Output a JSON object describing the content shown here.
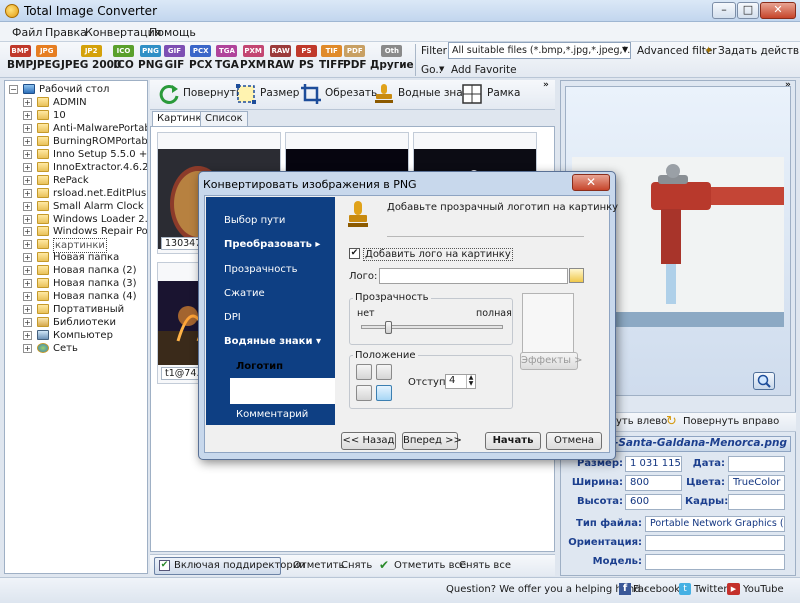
{
  "window": {
    "title": "Total Image Converter",
    "btn_min": "–",
    "btn_max": "□",
    "btn_close": "✕"
  },
  "menu": [
    "Файл",
    "Правка",
    "Конвертация",
    "Помощь"
  ],
  "formats": [
    {
      "badge": "BMP",
      "label": "BMP",
      "color": "#c0392b"
    },
    {
      "badge": "JPG",
      "label": "JPEG",
      "color": "#e67e22"
    },
    {
      "badge": "JP2",
      "label": "JPEG 2000",
      "color": "#d4a10a"
    },
    {
      "badge": "ICO",
      "label": "ICO",
      "color": "#5aa02c"
    },
    {
      "badge": "PNG",
      "label": "PNG",
      "color": "#2f8fc6"
    },
    {
      "badge": "GIF",
      "label": "GIF",
      "color": "#7d4fb3"
    },
    {
      "badge": "PCX",
      "label": "PCX",
      "color": "#3a66c9"
    },
    {
      "badge": "TGA",
      "label": "TGA",
      "color": "#b0449b"
    },
    {
      "badge": "PXM",
      "label": "PXM",
      "color": "#c34672"
    },
    {
      "badge": "RAW",
      "label": "RAW",
      "color": "#9c3b3b"
    },
    {
      "badge": "PS",
      "label": "PS",
      "color": "#c0392b"
    },
    {
      "badge": "TIF",
      "label": "TIFF",
      "color": "#e08a2a"
    },
    {
      "badge": "PDF",
      "label": "PDF",
      "color": "#c8a064"
    },
    {
      "badge": "Oth",
      "label": "Другие",
      "color": "#8a8a8a"
    }
  ],
  "filter": {
    "label": "Filter:",
    "value": "All suitable files (*.bmp,*.jpg,*.jpeg,*.ico,*.",
    "advanced": "Advanced filter",
    "set_actions": "Задать действия",
    "go": "Go..",
    "add_favorite": "Add Favorite"
  },
  "tree": [
    {
      "label": "Рабочий стол",
      "level": 0,
      "exp": "−",
      "kind": "desktop"
    },
    {
      "label": "ADMIN",
      "level": 1,
      "exp": "+",
      "kind": "folder"
    },
    {
      "label": "10",
      "level": 1,
      "exp": "+",
      "kind": "folder"
    },
    {
      "label": "Anti-MalwarePortable",
      "level": 1,
      "exp": "+",
      "kind": "folder"
    },
    {
      "label": "BurningROMPortable",
      "level": 1,
      "exp": "+",
      "kind": "folder"
    },
    {
      "label": "Inno Setup 5.5.0 + Rus",
      "level": 1,
      "exp": "+",
      "kind": "folder"
    },
    {
      "label": "InnoExtractor.4.6.2.151",
      "level": 1,
      "exp": "+",
      "kind": "folder"
    },
    {
      "label": "RePack",
      "level": 1,
      "exp": "+",
      "kind": "folder"
    },
    {
      "label": "rsload.net.EditPlus.3.70.1",
      "level": 1,
      "exp": "+",
      "kind": "folder"
    },
    {
      "label": "Small Alarm Clock",
      "level": 1,
      "exp": "+",
      "kind": "folder"
    },
    {
      "label": "Windows Loader 2.2.2 by D",
      "level": 1,
      "exp": "+",
      "kind": "folder"
    },
    {
      "label": "Windows Repair Portable",
      "level": 1,
      "exp": "+",
      "kind": "folder"
    },
    {
      "label": "картинки",
      "level": 1,
      "exp": "+",
      "kind": "folder"
    },
    {
      "label": "Новая папка",
      "level": 1,
      "exp": "+",
      "kind": "folder"
    },
    {
      "label": "Новая папка (2)",
      "level": 1,
      "exp": "+",
      "kind": "folder"
    },
    {
      "label": "Новая папка (3)",
      "level": 1,
      "exp": "+",
      "kind": "folder"
    },
    {
      "label": "Новая папка (4)",
      "level": 1,
      "exp": "+",
      "kind": "folder"
    },
    {
      "label": "Портативный",
      "level": 1,
      "exp": "+",
      "kind": "folder"
    },
    {
      "label": "Библиотеки",
      "level": 1,
      "exp": "+",
      "kind": "library"
    },
    {
      "label": "Компьютер",
      "level": 1,
      "exp": "+",
      "kind": "computer"
    },
    {
      "label": "Сеть",
      "level": 1,
      "exp": "+",
      "kind": "network"
    }
  ],
  "center_toolbar": {
    "rotate": "Повернуть",
    "size": "Размер",
    "crop": "Обрезать",
    "watermarks": "Водные знаки",
    "frame": "Рамка"
  },
  "tabs": {
    "thumbnails": "Картинки",
    "list": "Список"
  },
  "thumbs": [
    {
      "caption": "1303477…"
    },
    {
      "caption": ""
    },
    {
      "caption": ""
    },
    {
      "caption": "t1@74…"
    }
  ],
  "bottom_bar": {
    "include_subdirs": "Включая поддиректории",
    "mark": "Отметить",
    "unmark": "Снять",
    "mark_all": "Отметить все",
    "unmark_all": "Снять все"
  },
  "right_panel": {
    "rotate_left": "уть влево",
    "rotate_right": "Повернуть вправо",
    "filename": "ntain-Santa-Galdana-Menorca.png",
    "size_label": "Размер:",
    "size_value": "1 031 115",
    "date_label": "Дата:",
    "date_value": "",
    "width_label": "Ширина:",
    "width_value": "800",
    "colors_label": "Цвета:",
    "colors_value": "TrueColor",
    "height_label": "Высота:",
    "height_value": "600",
    "frames_label": "Кадры:",
    "frames_value": "",
    "filetype_label": "Тип файла:",
    "filetype_value": "Portable Network Graphics (PNG)",
    "orientation_label": "Ориентация:",
    "orientation_value": "",
    "model_label": "Модель:",
    "model_value": ""
  },
  "status": {
    "question": "Question? We offer you a helping hand -",
    "facebook": "Facebook",
    "twitter": "Twitter",
    "youtube": "YouTube"
  },
  "dialog": {
    "title": "Конвертировать изображения в PNG",
    "close": "✕",
    "nav": [
      {
        "label": "Выбор пути",
        "bold": false,
        "indent": 0
      },
      {
        "label": "Преобразовать ▸",
        "bold": true,
        "indent": 0
      },
      {
        "label": "Прозрачность",
        "bold": false,
        "indent": 0
      },
      {
        "label": "Сжатие",
        "bold": false,
        "indent": 0
      },
      {
        "label": "DPI",
        "bold": false,
        "indent": 0
      },
      {
        "label": "Водяные знаки ▾",
        "bold": true,
        "indent": 0
      },
      {
        "label": "Логотип",
        "bold": true,
        "indent": 1,
        "selected": true
      },
      {
        "label": "Рамка",
        "bold": false,
        "indent": 1
      },
      {
        "label": "Комментарий",
        "bold": false,
        "indent": 1
      }
    ],
    "header_text": "Добавьте прозрачный логотип на картинку",
    "add_logo_checkbox": "Добавить лого на картинку",
    "logo_label": "Лого:",
    "logo_value": "",
    "transparency_label": "Прозрачность",
    "slider_min_label": "нет",
    "slider_max_label": "полная",
    "slider_value": 0.18,
    "effects_button": "Эффекты >",
    "position_label": "Положение",
    "offset_label": "Отступ:",
    "offset_value": "4",
    "back_button": "<< Назад",
    "next_button": "Вперед >>",
    "start_button": "Начать",
    "cancel_button": "Отмена"
  }
}
